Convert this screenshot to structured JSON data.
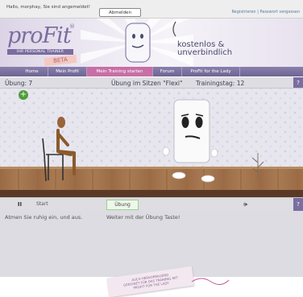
{
  "topbar": {
    "greeting": "Hallo, morphay, Sie sind angemeldet!",
    "logout_label": "Abmelden",
    "links": "Registrieren | Passwort vergessen"
  },
  "header": {
    "logo": "proFit",
    "logo_reg": "®",
    "logo_subtitle": "IHR PERSONAL TRAINER",
    "beta": "BETA",
    "slogan_line1": "kostenlos &",
    "slogan_line2": "unverbindlich"
  },
  "nav": {
    "items": [
      {
        "label": "Home"
      },
      {
        "label": "Mein Profil"
      },
      {
        "label": "Mein Training starten"
      },
      {
        "label": "Forum"
      },
      {
        "label": "ProFit for the Lady"
      }
    ]
  },
  "exercise": {
    "number": "Übung:  7",
    "title": "Übung im Sitzen \"Flexi\"",
    "day": "Trainingstag: 12",
    "help": "?"
  },
  "controls": {
    "pause": "II",
    "start_label": "Start",
    "exercise_label": "Übung",
    "sound": "🕪",
    "help": "?"
  },
  "info": {
    "instruction": "Atmen Sie ruhig ein, und aus.",
    "next": "Weiter mit der Übung Taste!"
  },
  "footer_card": {
    "line1": "AUCH HERVORRAGEND",
    "line2": "GEEIGNET FÜR DAS TRAINING MIT",
    "line3": "PROFIT FOR THE LADY"
  },
  "colors": {
    "brand_purple": "#7a6da0",
    "nav_active": "#c76fa6",
    "add_green": "#4f9d3a"
  }
}
